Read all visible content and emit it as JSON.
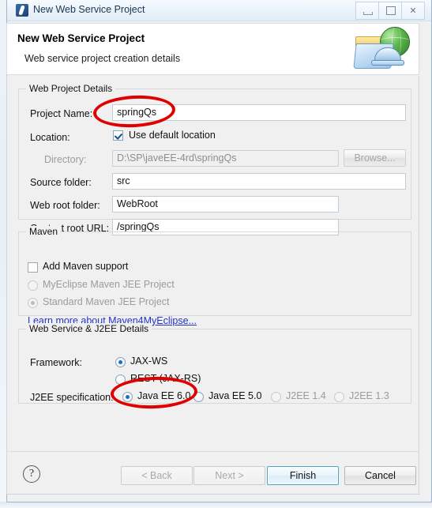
{
  "window": {
    "title": "New Web Service Project",
    "app_icon": "myeclipse-icon",
    "controls": {
      "minimize": "minimize-icon",
      "maximize": "maximize-icon",
      "close": "✕"
    }
  },
  "banner": {
    "title": "New Web Service Project",
    "subtitle": "Web service project creation details",
    "art": "web-service-folder-globe-icon"
  },
  "groups": {
    "web_project": {
      "legend": "Web Project Details",
      "fields": {
        "project_name_label": "Project Name:",
        "project_name_value": "springQs",
        "location_label": "Location:",
        "use_default_location_label": "Use default location",
        "use_default_location_checked": true,
        "directory_label": "Directory:",
        "directory_value": "D:\\SP\\javeEE-4rd\\springQs",
        "browse_label": "Browse...",
        "source_folder_label": "Source folder:",
        "source_folder_value": "src",
        "web_root_label": "Web root folder:",
        "web_root_value": "WebRoot",
        "context_root_label": "Context root URL:",
        "context_root_value": "/springQs"
      }
    },
    "maven": {
      "legend": "Maven",
      "add_support_label": "Add Maven support",
      "add_support_checked": false,
      "options": [
        {
          "label": "MyEclipse Maven JEE Project",
          "selected": false,
          "disabled": true
        },
        {
          "label": "Standard Maven JEE Project",
          "selected": true,
          "disabled": true
        }
      ],
      "link_label": "Learn more about Maven4MyEclipse..."
    },
    "web_service": {
      "legend": "Web Service & J2EE Details",
      "framework_label": "Framework:",
      "framework_options": [
        {
          "label": "JAX-WS",
          "selected": true,
          "disabled": false
        },
        {
          "label": "REST (JAX-RS)",
          "selected": false,
          "disabled": false
        }
      ],
      "j2ee_label": "J2EE specification:",
      "j2ee_options": [
        {
          "label": "Java EE 6.0",
          "selected": true,
          "disabled": false
        },
        {
          "label": "Java EE 5.0",
          "selected": false,
          "disabled": false
        },
        {
          "label": "J2EE 1.4",
          "selected": false,
          "disabled": true
        },
        {
          "label": "J2EE 1.3",
          "selected": false,
          "disabled": true
        }
      ]
    }
  },
  "buttonbar": {
    "help_label": "?",
    "back_label": "< Back",
    "next_label": "Next >",
    "finish_label": "Finish",
    "cancel_label": "Cancel"
  },
  "annotations": {
    "color": "#e00000",
    "ellipse_project_name": "highlight-project-name",
    "ellipse_j2ee_spec": "highlight-java-ee-6"
  }
}
